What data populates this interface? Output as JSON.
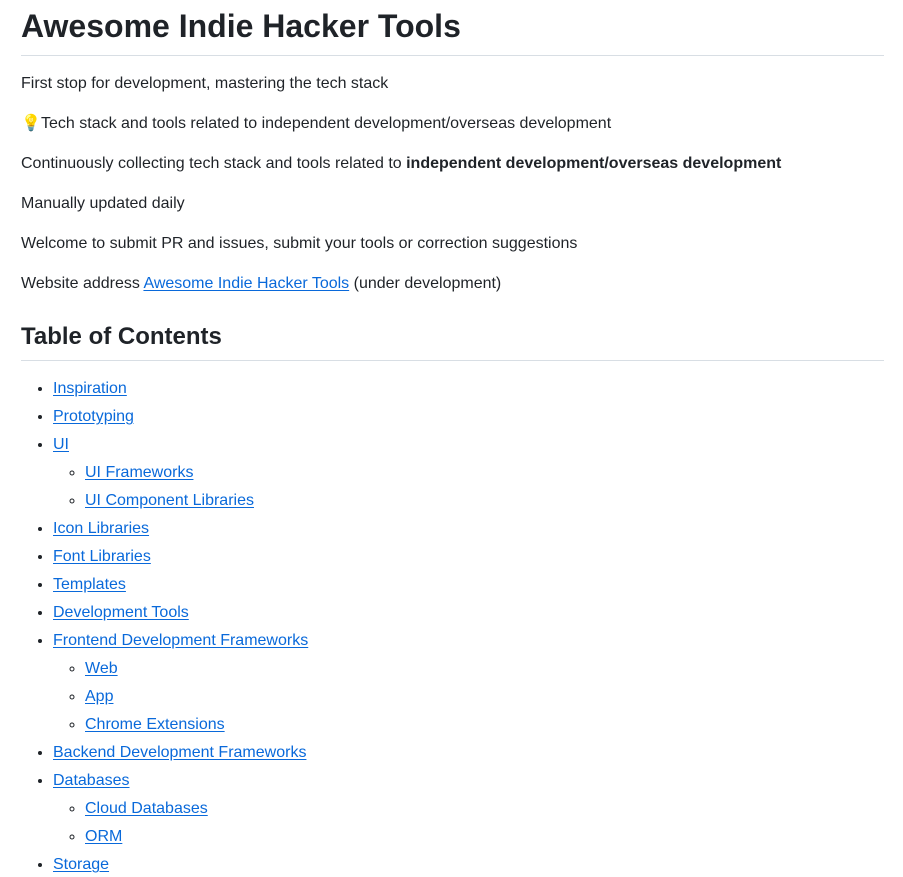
{
  "title": "Awesome Indie Hacker Tools",
  "intro": {
    "line1": "First stop for development, mastering the tech stack",
    "line2_icon": "lightbulb-icon",
    "line2_emoji": "💡",
    "line2": "Tech stack and tools related to independent development/overseas development",
    "line3_prefix": "Continuously collecting tech stack and tools related to ",
    "line3_bold": "independent development/overseas development",
    "line4": "Manually updated daily",
    "line5": "Welcome to submit PR and issues, submit your tools or correction suggestions",
    "line6_prefix": "Website address",
    "line6_link": "Awesome Indie Hacker Tools",
    "line6_suffix": " (under development)"
  },
  "toc": {
    "heading": "Table of Contents",
    "items": [
      {
        "label": "Inspiration"
      },
      {
        "label": "Prototyping"
      },
      {
        "label": "UI"
      },
      {
        "label": "UI Frameworks"
      },
      {
        "label": "UI Component Libraries"
      },
      {
        "label": "Icon Libraries"
      },
      {
        "label": "Font Libraries"
      },
      {
        "label": "Templates"
      },
      {
        "label": "Development Tools"
      },
      {
        "label": "Frontend Development Frameworks"
      },
      {
        "label": "Web"
      },
      {
        "label": "App"
      },
      {
        "label": "Chrome Extensions"
      },
      {
        "label": "Backend Development Frameworks"
      },
      {
        "label": "Databases"
      },
      {
        "label": "Cloud Databases"
      },
      {
        "label": "ORM"
      },
      {
        "label": "Storage"
      }
    ]
  },
  "colors": {
    "link": "#0969da",
    "text": "#1f2328",
    "divider": "#d8dee4"
  }
}
